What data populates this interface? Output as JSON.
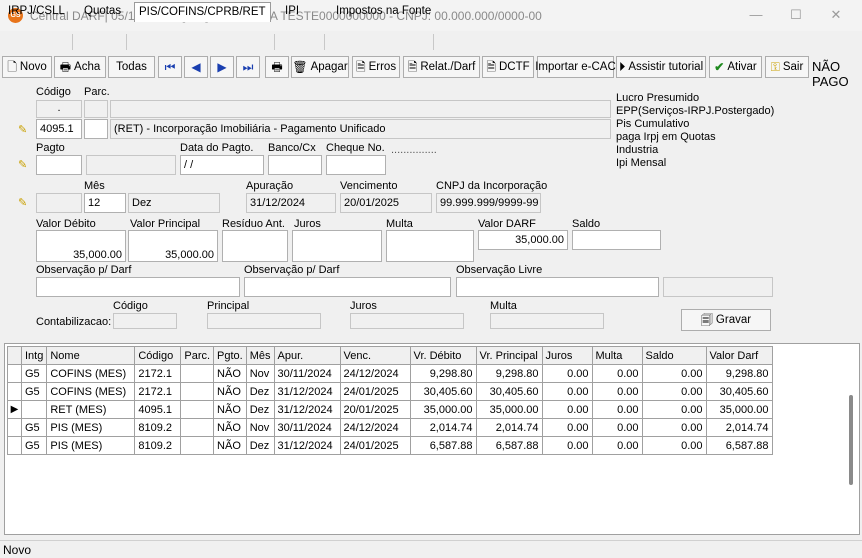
{
  "window": {
    "title": "Central DARF| 05/12/2024 - [100] - EMPRESA TESTE0000000000 - CNPJ: 00.000.000/0000-00",
    "icon_text": "GS",
    "min": "—",
    "max": "☐",
    "close": "✕"
  },
  "tabs": [
    {
      "label": "IRPJ/CSLL"
    },
    {
      "label": "Quotas"
    },
    {
      "label": "PIS/COFINS/CPRB/RET"
    },
    {
      "label": "IPI"
    },
    {
      "label": "Impostos na Fonte"
    }
  ],
  "toolbar": {
    "novo": "Novo",
    "acha": "Acha",
    "todas": "Todas",
    "apagar": "Apagar",
    "erros": "Erros",
    "relat": "Relat./Darf",
    "dctf": "DCTF",
    "importar": "Importar e-CAC",
    "assistir": "Assistir tutorial",
    "ativar": "Ativar",
    "sair": "Sair",
    "status": "NÃO PAGO"
  },
  "form": {
    "codigo_label": "Código",
    "parc_label": "Parc.",
    "codigo_top": ".",
    "codigo": "4095.1",
    "parc": "",
    "descricao": "(RET) - Incorporação Imobiliária - Pagamento Unificado",
    "pagto_label": "Pagto",
    "data_pagto_label": "Data do Pagto.",
    "banco_label": "Banco/Cx",
    "cheque_label": "Cheque No.",
    "data_pagto": " / /",
    "cheque_dots": "...............",
    "mes_label": "Mês",
    "mes_num": "12",
    "mes_nome": "Dez",
    "apuracao_label": "Apuração",
    "apuracao": "31/12/2024",
    "vencimento_label": "Vencimento",
    "vencimento": "20/01/2025",
    "cnpj_label": "CNPJ da Incorporação",
    "cnpj": "99.999.999/9999-99",
    "valor_debito_label": "Valor Débito",
    "valor_debito": "35,000.00",
    "valor_principal_label": "Valor Principal",
    "valor_principal": "35,000.00",
    "residuo_label": "Resíduo Ant.",
    "juros_label": "Juros",
    "multa_label": "Multa",
    "valor_darf_label": "Valor DARF",
    "valor_darf": "35,000.00",
    "saldo_label": "Saldo",
    "obs1_label": "Observação p/ Darf",
    "obs2_label": "Observação p/ Darf",
    "obs3_label": "Observação Livre",
    "contab_label": "Contabilizacao:",
    "contab_codigo_label": "Código",
    "contab_principal_label": "Principal",
    "contab_juros_label": "Juros",
    "contab_multa_label": "Multa",
    "gravar": "Gravar"
  },
  "company_info": [
    "Lucro Presumido",
    "EPP(Serviços-IRPJ.Postergado)",
    "Pis Cumulativo",
    "paga Irpj em Quotas",
    "Industria",
    "Ipi Mensal"
  ],
  "grid": {
    "columns": [
      "Intg",
      "Nome",
      "Código",
      "Parc.",
      "Pgto.",
      "Mês",
      "Apur.",
      "Venc.",
      "Vr. Débito",
      "Vr. Principal",
      "Juros",
      "Multa",
      "Saldo",
      "Valor Darf"
    ],
    "rows": [
      {
        "ind": "",
        "intg": "G5",
        "nome": "COFINS (MES)",
        "codigo": "2172.1",
        "parc": "",
        "pgto": "NÃO",
        "mes": "Nov",
        "apur": "30/11/2024",
        "venc": "24/12/2024",
        "debito": "9,298.80",
        "principal": "9,298.80",
        "juros": "0.00",
        "multa": "0.00",
        "saldo": "0.00",
        "darf": "9,298.80"
      },
      {
        "ind": "",
        "intg": "G5",
        "nome": "COFINS (MES)",
        "codigo": "2172.1",
        "parc": "",
        "pgto": "NÃO",
        "mes": "Dez",
        "apur": "31/12/2024",
        "venc": "24/01/2025",
        "debito": "30,405.60",
        "principal": "30,405.60",
        "juros": "0.00",
        "multa": "0.00",
        "saldo": "0.00",
        "darf": "30,405.60"
      },
      {
        "ind": "▶",
        "intg": "",
        "nome": "RET (MES)",
        "codigo": "4095.1",
        "parc": "",
        "pgto": "NÃO",
        "mes": "Dez",
        "apur": "31/12/2024",
        "venc": "20/01/2025",
        "debito": "35,000.00",
        "principal": "35,000.00",
        "juros": "0.00",
        "multa": "0.00",
        "saldo": "0.00",
        "darf": "35,000.00"
      },
      {
        "ind": "",
        "intg": "G5",
        "nome": "PIS (MES)",
        "codigo": "8109.2",
        "parc": "",
        "pgto": "NÃO",
        "mes": "Nov",
        "apur": "30/11/2024",
        "venc": "24/12/2024",
        "debito": "2,014.74",
        "principal": "2,014.74",
        "juros": "0.00",
        "multa": "0.00",
        "saldo": "0.00",
        "darf": "2,014.74"
      },
      {
        "ind": "",
        "intg": "G5",
        "nome": "PIS (MES)",
        "codigo": "8109.2",
        "parc": "",
        "pgto": "NÃO",
        "mes": "Dez",
        "apur": "31/12/2024",
        "venc": "24/01/2025",
        "debito": "6,587.88",
        "principal": "6,587.88",
        "juros": "0.00",
        "multa": "0.00",
        "saldo": "0.00",
        "darf": "6,587.88"
      }
    ]
  },
  "status_bar": "Novo"
}
